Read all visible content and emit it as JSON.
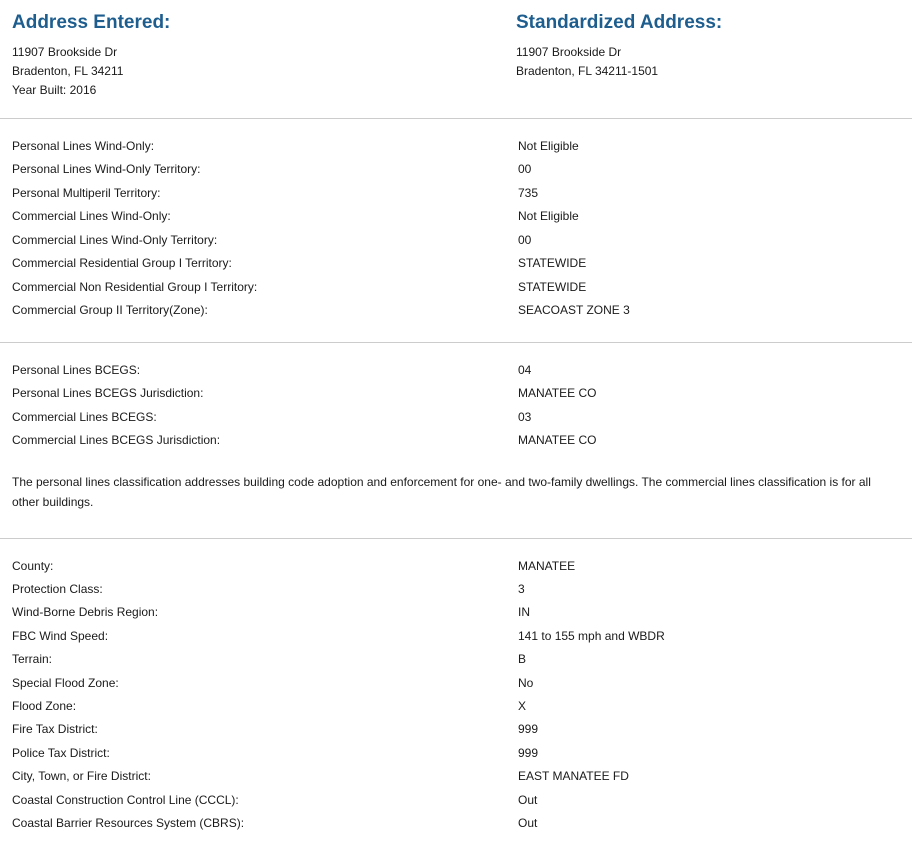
{
  "entered": {
    "title": "Address Entered:",
    "line1": "11907 Brookside Dr",
    "line2": "Bradenton, FL 34211",
    "line3": "Year Built: 2016"
  },
  "standardized": {
    "title": "Standardized Address:",
    "line1": "11907 Brookside Dr",
    "line2": "Bradenton, FL 34211-1501"
  },
  "wind": [
    {
      "label": "Personal Lines Wind-Only:",
      "value": "Not Eligible"
    },
    {
      "label": "Personal Lines Wind-Only Territory:",
      "value": "00"
    },
    {
      "label": "Personal Multiperil Territory:",
      "value": "735"
    },
    {
      "label": "Commercial Lines Wind-Only:",
      "value": "Not Eligible"
    },
    {
      "label": "Commercial Lines Wind-Only Territory:",
      "value": "00"
    },
    {
      "label": "Commercial Residential Group I Territory:",
      "value": "STATEWIDE"
    },
    {
      "label": "Commercial Non Residential Group I Territory:",
      "value": "STATEWIDE"
    },
    {
      "label": "Commercial Group II Territory(Zone):",
      "value": "SEACOAST ZONE 3"
    }
  ],
  "bcegs": [
    {
      "label": "Personal Lines BCEGS:",
      "value": "04"
    },
    {
      "label": "Personal Lines BCEGS Jurisdiction:",
      "value": "MANATEE CO"
    },
    {
      "label": "Commercial Lines BCEGS:",
      "value": "03"
    },
    {
      "label": "Commercial Lines BCEGS Jurisdiction:",
      "value": "MANATEE CO"
    }
  ],
  "bcegs_note": "The personal lines classification addresses building code adoption and enforcement for one- and two-family dwellings. The commercial lines classification is for all other buildings.",
  "location": [
    {
      "label": "County:",
      "value": "MANATEE"
    },
    {
      "label": "Protection Class:",
      "value": "3"
    },
    {
      "label": "Wind-Borne Debris Region:",
      "value": "IN"
    },
    {
      "label": "FBC Wind Speed:",
      "value": "141 to 155 mph and WBDR"
    },
    {
      "label": "Terrain:",
      "value": "B"
    },
    {
      "label": "Special Flood Zone:",
      "value": "No"
    },
    {
      "label": "Flood Zone:",
      "value": "X"
    },
    {
      "label": "Fire Tax District:",
      "value": "999"
    },
    {
      "label": "Police Tax District:",
      "value": "999"
    },
    {
      "label": "City, Town, or Fire District:",
      "value": "EAST MANATEE FD"
    },
    {
      "label": "Coastal Construction Control Line (CCCL):",
      "value": "Out"
    },
    {
      "label": "Coastal Barrier Resources System (CBRS):",
      "value": "Out"
    }
  ]
}
